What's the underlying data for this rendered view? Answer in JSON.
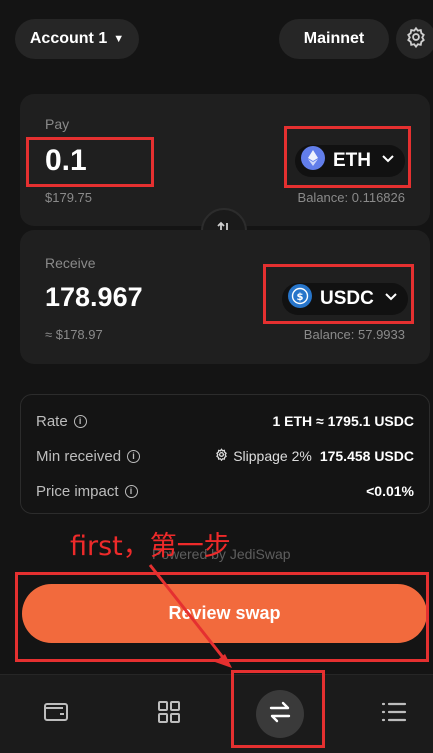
{
  "header": {
    "account_label": "Account 1",
    "network_label": "Mainnet",
    "settings_icon": "gear-icon"
  },
  "pay": {
    "label": "Pay",
    "amount": "0.1",
    "usd_value": "$179.75",
    "token": "ETH",
    "token_icon": "eth-icon",
    "balance": "Balance: 0.116826"
  },
  "receive": {
    "label": "Receive",
    "amount": "178.967",
    "usd_value": "≈ $178.97",
    "token": "USDC",
    "token_icon": "usdc-icon",
    "balance": "Balance: 57.9933"
  },
  "details": {
    "rate_label": "Rate",
    "rate_value": "1 ETH ≈ 1795.1 USDC",
    "min_label": "Min received",
    "slippage": "Slippage 2%",
    "min_value": "175.458 USDC",
    "impact_label": "Price impact",
    "impact_value": "<0.01%"
  },
  "powered_by": "Powered by JediSwap",
  "review_button": "Review swap",
  "annotation": "first，第一步",
  "nav": {
    "items": [
      "wallet-icon",
      "grid-icon",
      "swap-icon",
      "list-icon"
    ]
  },
  "colors": {
    "accent": "#f26a3d",
    "annotation": "#e53030",
    "eth": "#627eea",
    "usdc": "#2775ca"
  }
}
